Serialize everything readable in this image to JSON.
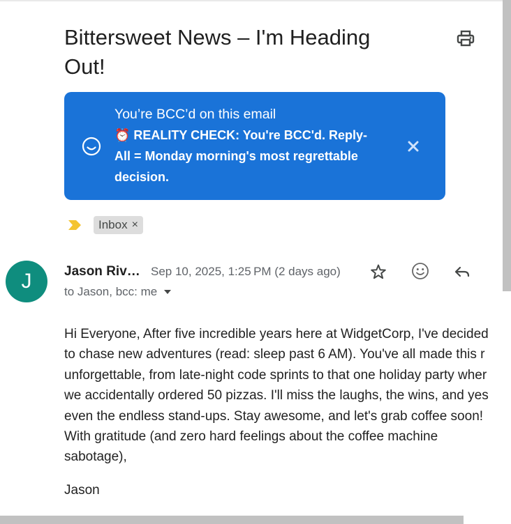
{
  "email": {
    "subject_line1": "Bittersweet News – I'm Heading",
    "subject_line2": "Out!",
    "banner": {
      "title": "You’re BCC’d on this email",
      "line1": "⏰ REALITY CHECK: You're BCC'd. Reply-",
      "line2": "All = Monday morning's most regrettable",
      "line3": "decision.",
      "close": "✕"
    },
    "labels": {
      "inbox": "Inbox",
      "remove": "×"
    },
    "sender": {
      "initial": "J",
      "name": "Jason Riv…",
      "date": "Sep 10, 2025, 1:25 PM (2 days ago)",
      "recipients": "to Jason, bcc: me"
    },
    "body_lines": [
      "Hi Everyone, After five incredible years here at WidgetCorp, I've decided",
      "to chase new adventures (read: sleep past 6 AM). You've all made this r",
      "unforgettable, from late-night code sprints to that one holiday party wher",
      "we accidentally ordered 50 pizzas. I'll miss the laughs, the wins, and yes",
      "even the endless stand-ups. Stay awesome, and let's grab coffee soon!",
      "With gratitude (and zero hard feelings about the coffee machine",
      "sabotage),"
    ],
    "signature": "Jason"
  },
  "icons": {
    "print": "printer-icon",
    "banner": "smiley-icon",
    "close": "close-icon",
    "importance": "importance-marker-icon",
    "star": "star-icon",
    "emoji": "emoji-reaction-icon",
    "reply": "reply-icon",
    "caret": "chevron-down-icon"
  },
  "colors": {
    "banner_bg": "#1a73d8",
    "avatar_bg": "#0f8d7e",
    "importance": "#f4c430",
    "chip_bg": "#dddddd"
  }
}
